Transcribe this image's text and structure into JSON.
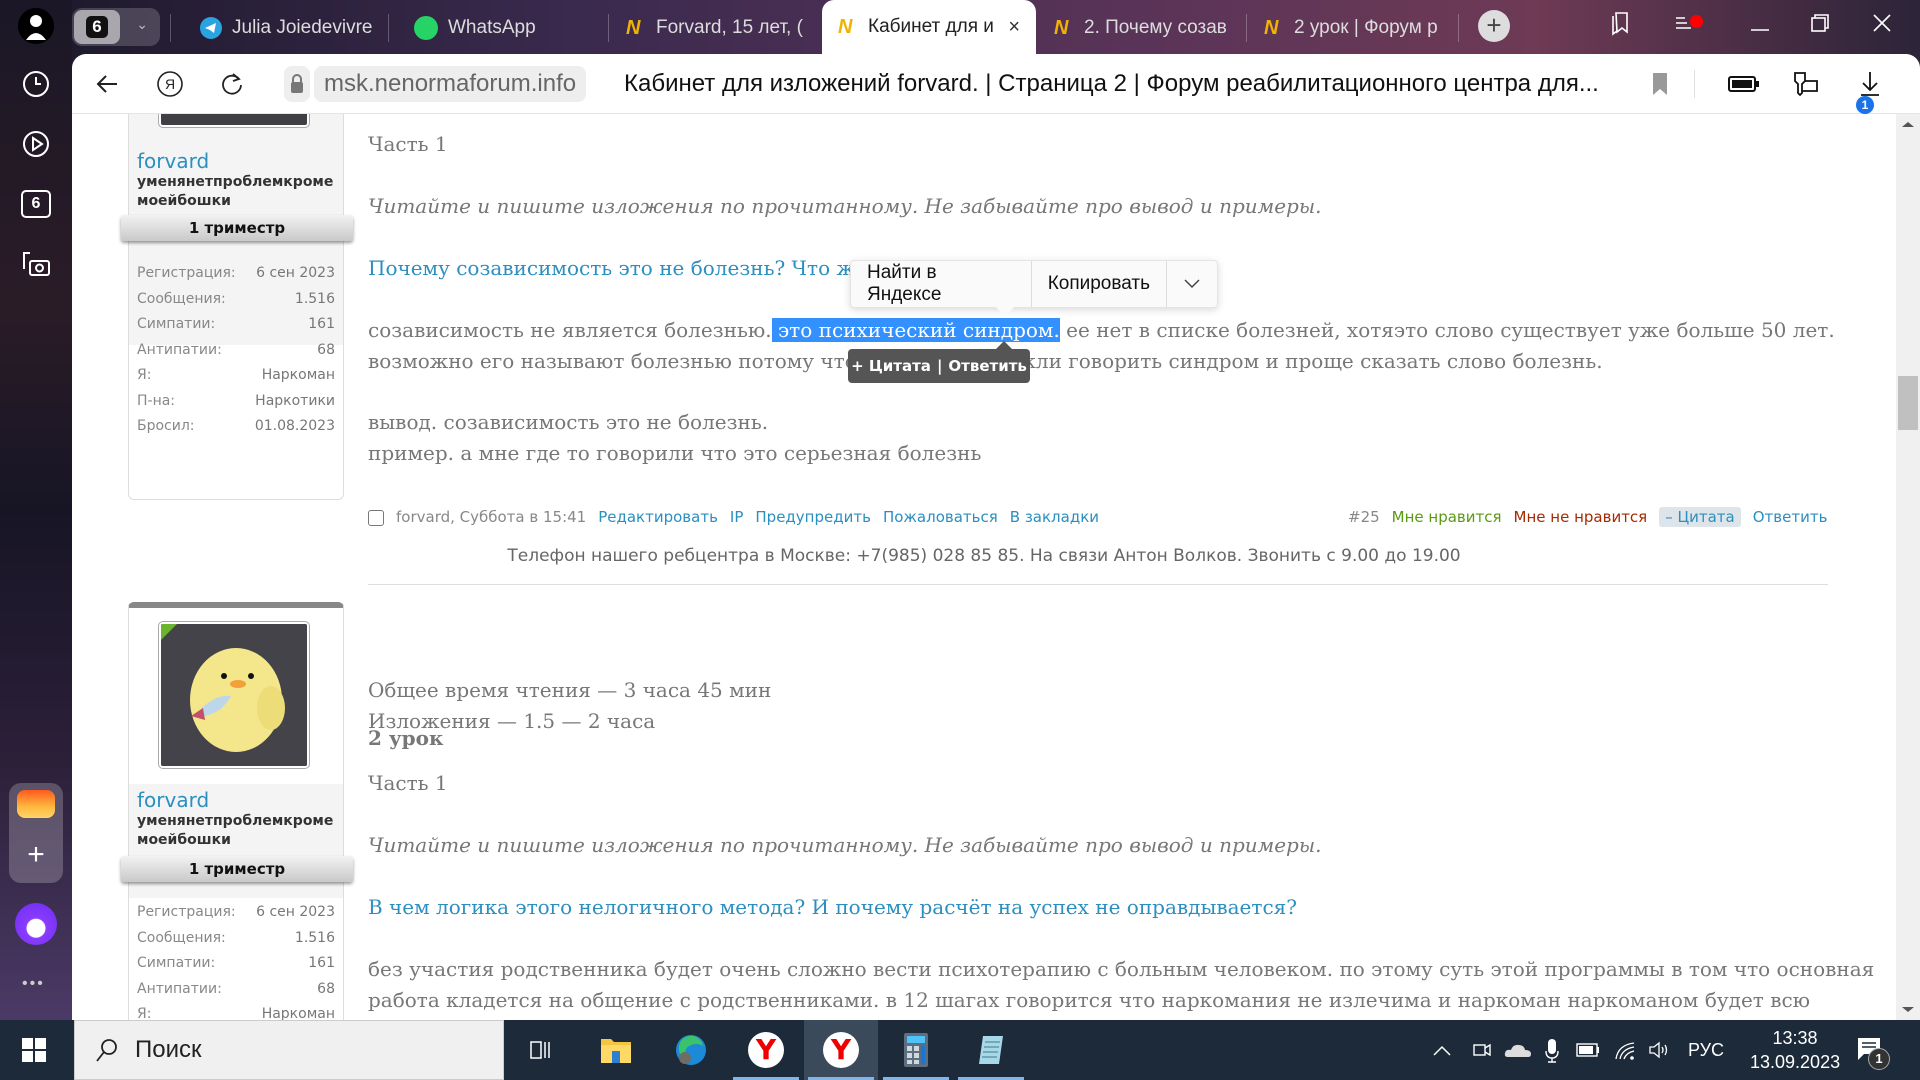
{
  "browser": {
    "tab_count": "6",
    "tabs": [
      {
        "label": "Julia Joiedevivre",
        "icon": "telegram-icon"
      },
      {
        "label": "WhatsApp",
        "icon": "whatsapp-icon"
      },
      {
        "label": "Forvard, 15 лет, (",
        "icon": "forum-favicon"
      },
      {
        "label": "Кабинет для и",
        "icon": "forum-favicon",
        "active": true
      },
      {
        "label": "2. Почему созав",
        "icon": "forum-favicon"
      },
      {
        "label": "2 урок | Форум р",
        "icon": "forum-favicon"
      }
    ],
    "new_tab_label": "+",
    "url": "msk.nenormaforum.info",
    "page_title": "Кабинет для изложений forvard. | Страница 2 | Форум реабилитационного центра для...",
    "downloads_badge": "1"
  },
  "sidebar": {
    "tabs_badge": "6"
  },
  "context_menu": {
    "items": [
      "Найти в Яндексе",
      "Копировать"
    ],
    "more_icon": "chevron-down-icon"
  },
  "quote_popup": {
    "quote": "+ Цитата",
    "sep": "|",
    "reply": "Ответить"
  },
  "posts": [
    {
      "user": {
        "name": "forvard",
        "title": "уменянетпроблемкроме моейбошки",
        "rank": "1 триместр",
        "stats": [
          {
            "label": "Регистрация:",
            "value": "6 сен 2023"
          },
          {
            "label": "Сообщения:",
            "value": "1.516"
          },
          {
            "label": "Симпатии:",
            "value": "161"
          },
          {
            "label": "Антипатии:",
            "value": "68"
          },
          {
            "label": "Я:",
            "value": "Наркоман"
          },
          {
            "label": "П-на:",
            "value": "Наркотики"
          },
          {
            "label": "Бросил:",
            "value": "01.08.2023"
          }
        ]
      },
      "part": "Часть 1",
      "instruction": "Читайте и пишите изложения по прочитанному. Не забывайте про вывод и примеры.",
      "question": "Почему созависимость это не болезнь? Что же",
      "question_tail": "?",
      "body_line1_pre": "созависимость не является болезнью.",
      "body_line1_selected": " это психический синдром.",
      "body_line1_post": " ее нет в списке болезней, хотяэто слово существует уже больше 50 лет.",
      "body_line2": "возможно его называют болезнью потому что люди не привыкли говорить синдром и проще сказать слово болезнь.",
      "conclusion": "вывод. созависимость это не болезнь.",
      "example": "пример. а мне где то говорили что это серьезная болезнь",
      "footer": {
        "author_time": "forvard, Суббота в 15:41",
        "actions": [
          "Редактировать",
          "IP",
          "Предупредить",
          "Пожаловаться",
          "В закладки"
        ],
        "number": "#25",
        "like": "Мне нравится",
        "dislike": "Мне не нравится",
        "quote": "– Цитата",
        "reply": "Ответить"
      },
      "phone_notice": "Телефон нашего ребцентра в Москве: +7(985) 028 85 85. На связи Антон Волков. Звонить с 9.00 до 19.00"
    },
    {
      "user": {
        "name": "forvard",
        "title": "уменянетпроблемкроме моейбошки",
        "rank": "1 триместр",
        "stats": [
          {
            "label": "Регистрация:",
            "value": "6 сен 2023"
          },
          {
            "label": "Сообщения:",
            "value": "1.516"
          },
          {
            "label": "Симпатии:",
            "value": "161"
          },
          {
            "label": "Антипатии:",
            "value": "68"
          },
          {
            "label": "Я:",
            "value": "Наркоман"
          }
        ]
      },
      "heading": "2 урок",
      "reading_time": "Общее время чтения — 3 часа 45 мин",
      "essay_time": "Изложения — 1.5 — 2 часа",
      "part": "Часть 1",
      "instruction": "Читайте и пишите изложения по прочитанному. Не забывайте про вывод и примеры.",
      "question": "В чем логика этого нелогичного метода? И почему расчёт на успех не оправдывается?",
      "body_line1": "без участия родственника будет очень сложно вести психотерапию с больным человеком. по этому суть этой программы в том что основная",
      "body_line2": "работа кладется на общение с родственниками. в 12 шагах говорится что наркомания не излечима и наркоман наркоманом будет всю"
    }
  ],
  "taskbar": {
    "search_placeholder": "Поиск",
    "language": "РУС",
    "time": "13:38",
    "date": "13.09.2023",
    "notifications_badge": "1"
  }
}
